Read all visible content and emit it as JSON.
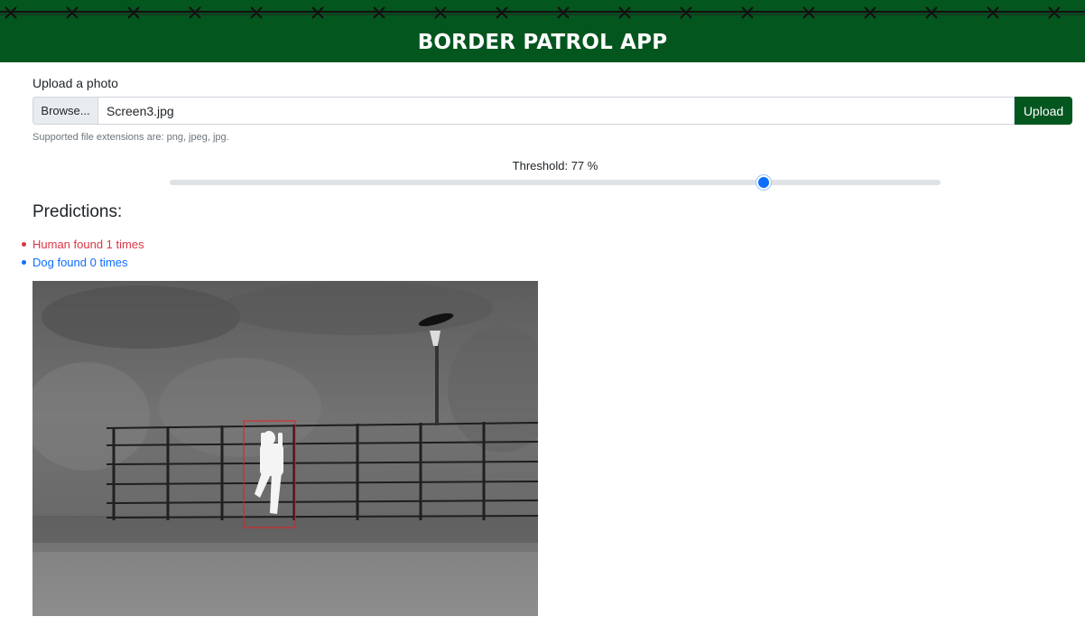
{
  "header": {
    "title": "BORDER PATROL APP"
  },
  "upload": {
    "label": "Upload a photo",
    "browse_label": "Browse...",
    "file_name": "Screen3.jpg",
    "upload_button": "Upload",
    "help_text": "Supported file extensions are: png, jpeg, jpg."
  },
  "threshold": {
    "label": "Threshold: 77 %",
    "value": 77
  },
  "predictions": {
    "title": "Predictions:",
    "items": [
      {
        "label": "Human found 1 times",
        "color": "#dc3545"
      },
      {
        "label": "Dog found 0 times",
        "color": "#0d6efd"
      }
    ]
  },
  "colors": {
    "brand": "#04561f",
    "accent": "#0d6efd",
    "human": "#dc3545",
    "detection_box": "#e02020"
  },
  "icons": {
    "header_decoration": "barbed-wire-icon",
    "list_bullet": "bullet-icon"
  }
}
